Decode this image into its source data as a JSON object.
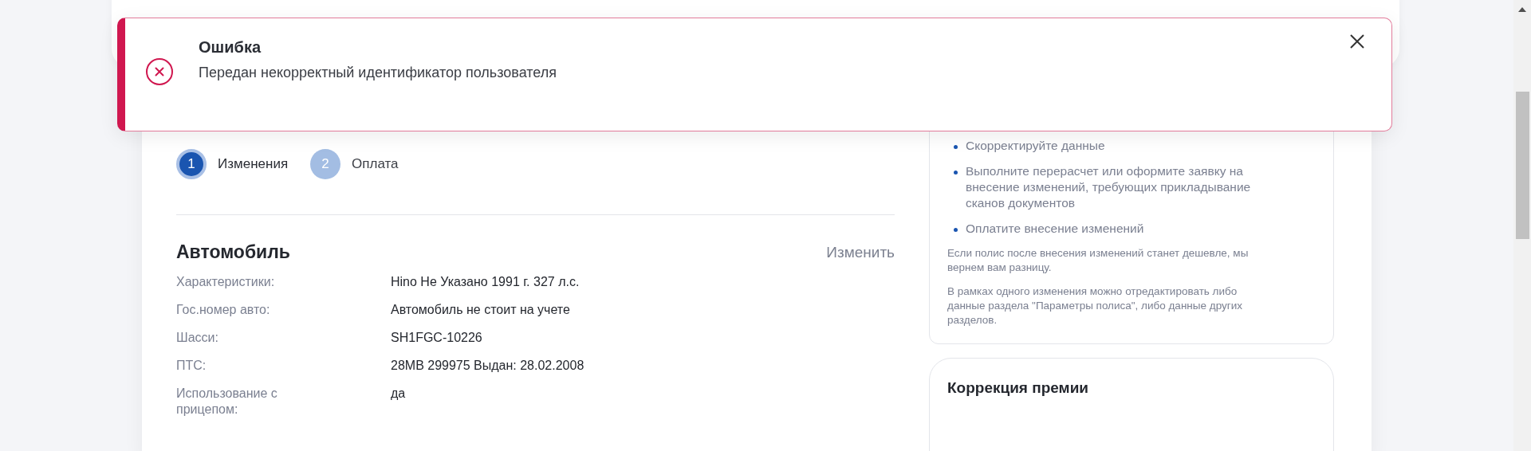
{
  "toast": {
    "kind": "error",
    "title": "Ошибка",
    "message": "Передан некорректный идентификатор пользователя"
  },
  "steps": [
    {
      "number": "1",
      "label": "Изменения",
      "selected": true
    },
    {
      "number": "2",
      "label": "Оплата",
      "selected": false
    }
  ],
  "vehicle": {
    "title": "Автомобиль",
    "edit_link": "Изменить",
    "rows": [
      {
        "label": "Характеристики:",
        "value": "Hino Не Указано 1991 г. 327 л.с."
      },
      {
        "label": "Гос.номер авто:",
        "value": "Автомобиль не стоит на учете"
      },
      {
        "label": "Шасси:",
        "value": "SH1FGC-10226"
      },
      {
        "label": "ПТС:",
        "value": "28MB 299975 Выдан: 28.02.2008"
      },
      {
        "label": "Использование с прицепом:",
        "value": "да"
      }
    ]
  },
  "info_card": {
    "steps": [
      "Скорректируйте данные",
      "Выполните перерасчет или оформите заявку на внесение изменений, требующих прикладывание сканов документов",
      "Оплатите внесение изменений"
    ],
    "notes": [
      "Если полис после внесения изменений станет дешевле, мы вернем вам разницу.",
      "В рамках одного изменения можно отредактировать либо данные раздела \"Параметры полиса\", либо данные других разделов."
    ]
  },
  "premium_card": {
    "title": "Коррекция премии"
  }
}
